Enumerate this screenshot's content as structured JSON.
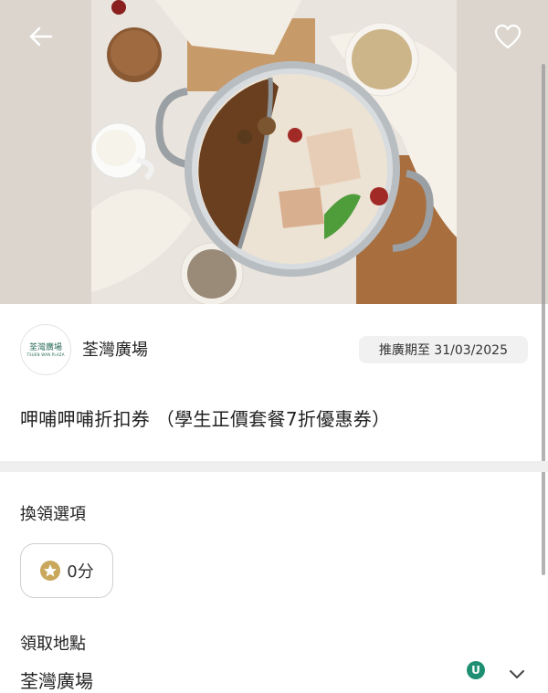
{
  "header": {
    "back_icon": "arrow-left-icon",
    "favorite_icon": "heart-outline-icon"
  },
  "merchant": {
    "logo_text_cn": "荃灣廣場",
    "logo_text_en": "TSUEN WAN PLAZA",
    "name": "荃灣廣場",
    "promotion_period": "推廣期至 31/03/2025"
  },
  "offer": {
    "title": "呷哺呷哺折扣券 （學生正價套餐7折優惠券）"
  },
  "redeem": {
    "section_label": "換領選項",
    "points_icon": "star-coin-icon",
    "points_label": "0分"
  },
  "pickup": {
    "section_label": "領取地點",
    "location": "荃灣廣場",
    "badge": "U",
    "dropdown_icon": "chevron-down-icon"
  },
  "colors": {
    "accent_green": "#1f8f73",
    "star_gold": "#c9a85c",
    "divider": "#efefef"
  }
}
